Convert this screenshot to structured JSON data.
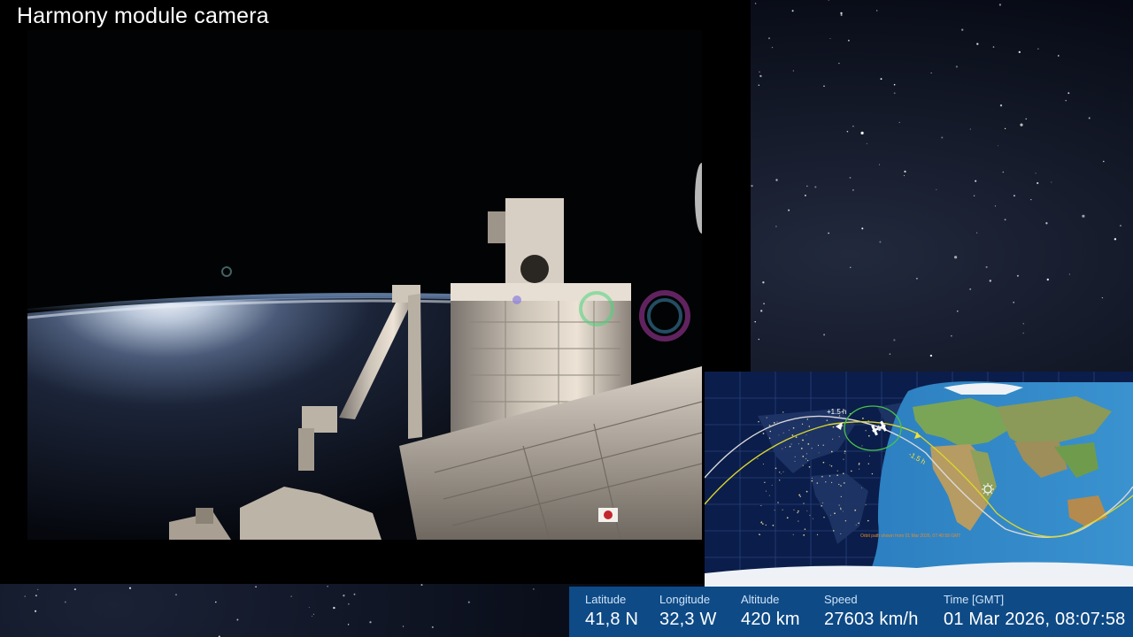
{
  "camera": {
    "title": "Harmony module camera"
  },
  "map": {
    "marker_plus": "+1.5 h",
    "marker_minus": "-1.5 h",
    "caption": "Orbit path shown from 01 Mar 2026, 07:40:58 GMT"
  },
  "telemetry": {
    "latitude": {
      "label": "Latitude",
      "value": "41,8 N"
    },
    "longitude": {
      "label": "Longitude",
      "value": "32,3 W"
    },
    "altitude": {
      "label": "Altitude",
      "value": "420 km"
    },
    "speed": {
      "label": "Speed",
      "value": "27603 km/h"
    },
    "time": {
      "label": "Time [GMT]",
      "value": "01 Mar 2026, 08:07:58"
    }
  },
  "colors": {
    "telemetry_bar": "#0e4a86",
    "map_night": "#0b1d4a",
    "map_day_ocean": "#2f86c6",
    "orbit_current": "#d9d9d9",
    "orbit_next": "#d9d62e"
  },
  "icons": [
    "iss-icon",
    "sun-icon"
  ]
}
